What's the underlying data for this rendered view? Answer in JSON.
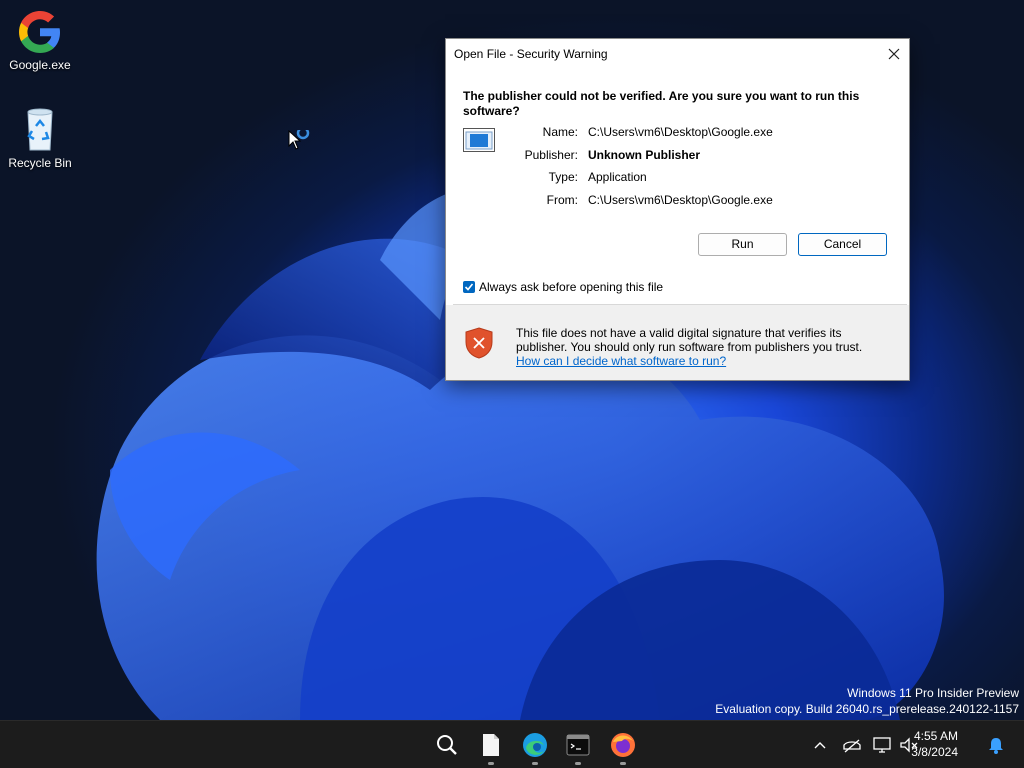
{
  "desktop": {
    "icons": [
      {
        "label": "Google.exe",
        "icon": "google-icon"
      },
      {
        "label": "Recycle Bin",
        "icon": "recycle-bin-icon"
      }
    ],
    "watermark": {
      "line1": "Windows 11 Pro Insider Preview",
      "line2": "Evaluation copy. Build 26040.rs_prerelease.240122-1157"
    }
  },
  "dialog": {
    "title": "Open File - Security Warning",
    "question": "The publisher could not be verified.  Are you sure you want to run this software?",
    "fields": [
      {
        "label": "Name:",
        "value": "C:\\Users\\vm6\\Desktop\\Google.exe"
      },
      {
        "label": "Publisher:",
        "value": "Unknown Publisher"
      },
      {
        "label": "Type:",
        "value": "Application"
      },
      {
        "label": "From:",
        "value": "C:\\Users\\vm6\\Desktop\\Google.exe"
      }
    ],
    "run_label": "Run",
    "cancel_label": "Cancel",
    "checkbox_label": "Always ask before opening this file",
    "checkbox_checked": true,
    "warning_text": "This file does not have a valid digital signature that verifies its publisher.  You should only run software from publishers you trust.",
    "help_link": "How can I decide what software to run?"
  },
  "taskbar": {
    "apps": [
      "search-icon",
      "file-explorer-icon",
      "edge-icon",
      "terminal-icon",
      "firefox-icon"
    ],
    "tray": [
      "chevron-up-icon",
      "network-off-icon",
      "display-icon",
      "volume-muted-icon",
      "notification-bell-icon"
    ],
    "time": "4:55 AM",
    "date": "3/8/2024"
  },
  "colors": {
    "accent": "#0067c0",
    "taskbar": "#1c1c1c",
    "link": "#0066cc",
    "shield": "#e0522c"
  }
}
